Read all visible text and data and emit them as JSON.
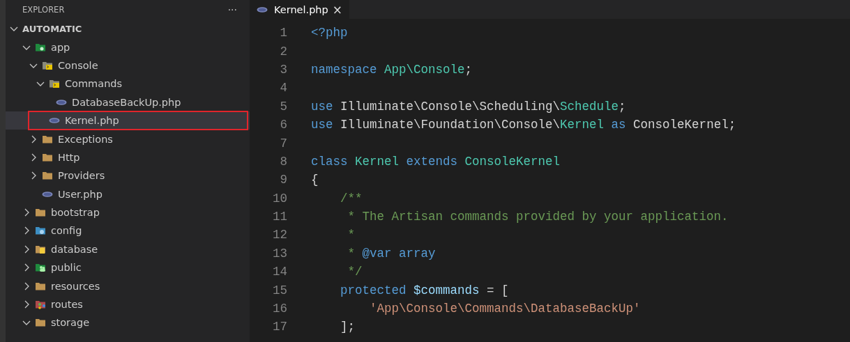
{
  "sidebar": {
    "title": "EXPLORER",
    "more_button": "···",
    "tree": [
      {
        "label": "AUTOMATIC",
        "kind": "root",
        "expanded": true,
        "children": [
          {
            "label": "app",
            "kind": "app",
            "expanded": true,
            "children": [
              {
                "label": "Console",
                "kind": "console",
                "expanded": true,
                "children": [
                  {
                    "label": "Commands",
                    "kind": "console",
                    "expanded": true,
                    "children": [
                      {
                        "label": "DatabaseBackUp.php",
                        "kind": "php",
                        "selected": false,
                        "annotated": false
                      }
                    ]
                  },
                  {
                    "label": "Kernel.php",
                    "kind": "php",
                    "selected": true,
                    "annotated": true
                  }
                ]
              },
              {
                "label": "Exceptions",
                "kind": "folder",
                "expanded": false
              },
              {
                "label": "Http",
                "kind": "folder",
                "expanded": false
              },
              {
                "label": "Providers",
                "kind": "folder",
                "expanded": false
              },
              {
                "label": "User.php",
                "kind": "php",
                "selected": false,
                "annotated": false
              }
            ]
          },
          {
            "label": "bootstrap",
            "kind": "folder",
            "expanded": false
          },
          {
            "label": "config",
            "kind": "config",
            "expanded": false
          },
          {
            "label": "database",
            "kind": "database",
            "expanded": false
          },
          {
            "label": "public",
            "kind": "public",
            "expanded": false
          },
          {
            "label": "resources",
            "kind": "folder",
            "expanded": false
          },
          {
            "label": "routes",
            "kind": "routes",
            "expanded": false
          },
          {
            "label": "storage",
            "kind": "folder",
            "expanded": true
          }
        ]
      }
    ]
  },
  "tabs": [
    {
      "label": "Kernel.php",
      "close": "×",
      "selected": true
    }
  ],
  "code": [
    {
      "number": "1",
      "tokens": [
        {
          "text": "<?php",
          "kind": "keyword"
        }
      ]
    },
    {
      "number": "2"
    },
    {
      "number": "3",
      "tokens": [
        {
          "text": "namespace ",
          "kind": "keyword"
        },
        {
          "text": "App\\Console",
          "kind": "type"
        },
        {
          "text": ";",
          "kind": "plain"
        }
      ]
    },
    {
      "number": "4"
    },
    {
      "number": "5",
      "tokens": [
        {
          "text": "use ",
          "kind": "keyword"
        },
        {
          "text": "Illuminate\\Console\\Scheduling\\",
          "kind": "plain"
        },
        {
          "text": "Schedule",
          "kind": "type"
        },
        {
          "text": ";",
          "kind": "plain"
        }
      ]
    },
    {
      "number": "6",
      "tokens": [
        {
          "text": "use ",
          "kind": "keyword"
        },
        {
          "text": "Illuminate\\Foundation\\Console\\",
          "kind": "plain"
        },
        {
          "text": "Kernel",
          "kind": "type"
        },
        {
          "text": " as ",
          "kind": "keyword"
        },
        {
          "text": "ConsoleKernel;",
          "kind": "plain"
        }
      ]
    },
    {
      "number": "7"
    },
    {
      "number": "8",
      "tokens": [
        {
          "text": "class ",
          "kind": "keyword"
        },
        {
          "text": "Kernel",
          "kind": "type"
        },
        {
          "text": " extends ",
          "kind": "keyword"
        },
        {
          "text": "ConsoleKernel",
          "kind": "type"
        }
      ]
    },
    {
      "number": "9",
      "tokens": [
        {
          "text": "{",
          "kind": "plain"
        }
      ]
    },
    {
      "number": "10",
      "kind": "member",
      "tokens": [
        {
          "text": "/**",
          "kind": "comment"
        }
      ]
    },
    {
      "number": "11",
      "kind": "doc",
      "tokens": [
        {
          "text": "* The Artisan commands provided by your application.",
          "kind": "comment"
        }
      ]
    },
    {
      "number": "12",
      "kind": "doc",
      "tokens": [
        {
          "text": "*",
          "kind": "comment"
        }
      ]
    },
    {
      "number": "13",
      "kind": "doc",
      "tokens": [
        {
          "text": "* ",
          "kind": "comment"
        },
        {
          "text": "@var array",
          "kind": "keyword"
        }
      ]
    },
    {
      "number": "14",
      "kind": "doc",
      "tokens": [
        {
          "text": "*/",
          "kind": "comment"
        }
      ]
    },
    {
      "number": "15",
      "kind": "member",
      "tokens": [
        {
          "text": "protected ",
          "kind": "keyword"
        },
        {
          "text": "$commands",
          "kind": "variable"
        },
        {
          "text": " = [",
          "kind": "plain"
        }
      ]
    },
    {
      "number": "16",
      "kind": "nested",
      "tokens": [
        {
          "text": "'App\\Console\\Commands\\DatabaseBackUp'",
          "kind": "string"
        }
      ]
    },
    {
      "number": "17",
      "kind": "member",
      "tokens": [
        {
          "text": "];",
          "kind": "plain"
        }
      ]
    }
  ]
}
